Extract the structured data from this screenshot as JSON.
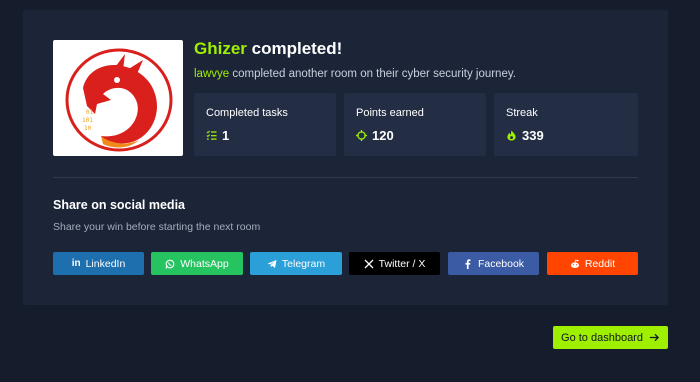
{
  "completion": {
    "room_name": "Ghizer",
    "completed_suffix": " completed!",
    "username": "lawvye",
    "message": " completed another room on their cyber security journey."
  },
  "logo": {
    "icon": "red-dragon-logo",
    "colors": {
      "dragon": "#d9201c",
      "accent": "#f08a1c"
    }
  },
  "stats": [
    {
      "label": "Completed tasks",
      "value": "1",
      "icon": "task-list-icon"
    },
    {
      "label": "Points earned",
      "value": "120",
      "icon": "crosshair-icon"
    },
    {
      "label": "Streak",
      "value": "339",
      "icon": "flame-icon"
    }
  ],
  "share": {
    "title": "Share on social media",
    "subtitle": "Share your win before starting the next room",
    "buttons": [
      {
        "label": "LinkedIn",
        "icon": "linkedin-icon",
        "color": "#1d6fae"
      },
      {
        "label": "WhatsApp",
        "icon": "whatsapp-icon",
        "color": "#25c461"
      },
      {
        "label": "Telegram",
        "icon": "telegram-icon",
        "color": "#2a9fd8"
      },
      {
        "label": "Twitter / X",
        "icon": "x-icon",
        "color": "#000000"
      },
      {
        "label": "Facebook",
        "icon": "facebook-icon",
        "color": "#3b5ba5"
      },
      {
        "label": "Reddit",
        "icon": "reddit-icon",
        "color": "#ff4500"
      }
    ]
  },
  "dashboard_button": {
    "label": "Go to dashboard",
    "icon": "arrow-right-icon"
  },
  "theme": {
    "accent": "#9fef00",
    "background": "#151c2b",
    "card": "#1c2538",
    "stat_card": "#232e45"
  }
}
